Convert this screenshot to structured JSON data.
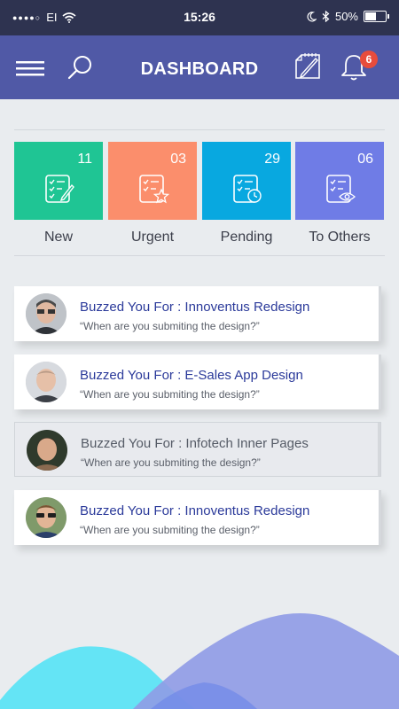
{
  "status_bar": {
    "carrier": "EI",
    "time": "15:26",
    "battery": "50%"
  },
  "header": {
    "title": "DASHBOARD",
    "notification_count": "6",
    "icons": [
      "menu-icon",
      "search-icon",
      "compose-icon",
      "bell-icon"
    ]
  },
  "tiles": [
    {
      "label": "New",
      "count": "11",
      "color": "#1fc594",
      "icon": "checklist-pencil-icon"
    },
    {
      "label": "Urgent",
      "count": "03",
      "color": "#fb8e6c",
      "icon": "checklist-star-icon"
    },
    {
      "label": "Pending",
      "count": "29",
      "color": "#08a8e0",
      "icon": "checklist-clock-icon"
    },
    {
      "label": "To Others",
      "count": "06",
      "color": "#6f7ce6",
      "icon": "checklist-eye-icon"
    }
  ],
  "buzzes": [
    {
      "title": "Buzzed You For : Innoventus Redesign",
      "message": "“When are you submiting the design?”"
    },
    {
      "title": "Buzzed You For : E-Sales App Design",
      "message": "“When are you submiting the design?”"
    },
    {
      "title": "Buzzed You For : Infotech Inner Pages",
      "message": "“When are you submiting the design?”"
    },
    {
      "title": "Buzzed You For : Innoventus Redesign",
      "message": "“When are you submiting the design?”"
    }
  ],
  "colors": {
    "header": "#5059a6",
    "status_bar": "#2e3350",
    "background": "#e9ecef",
    "wave_cyan": "#55e3f5",
    "wave_purple": "#8f9be6"
  }
}
